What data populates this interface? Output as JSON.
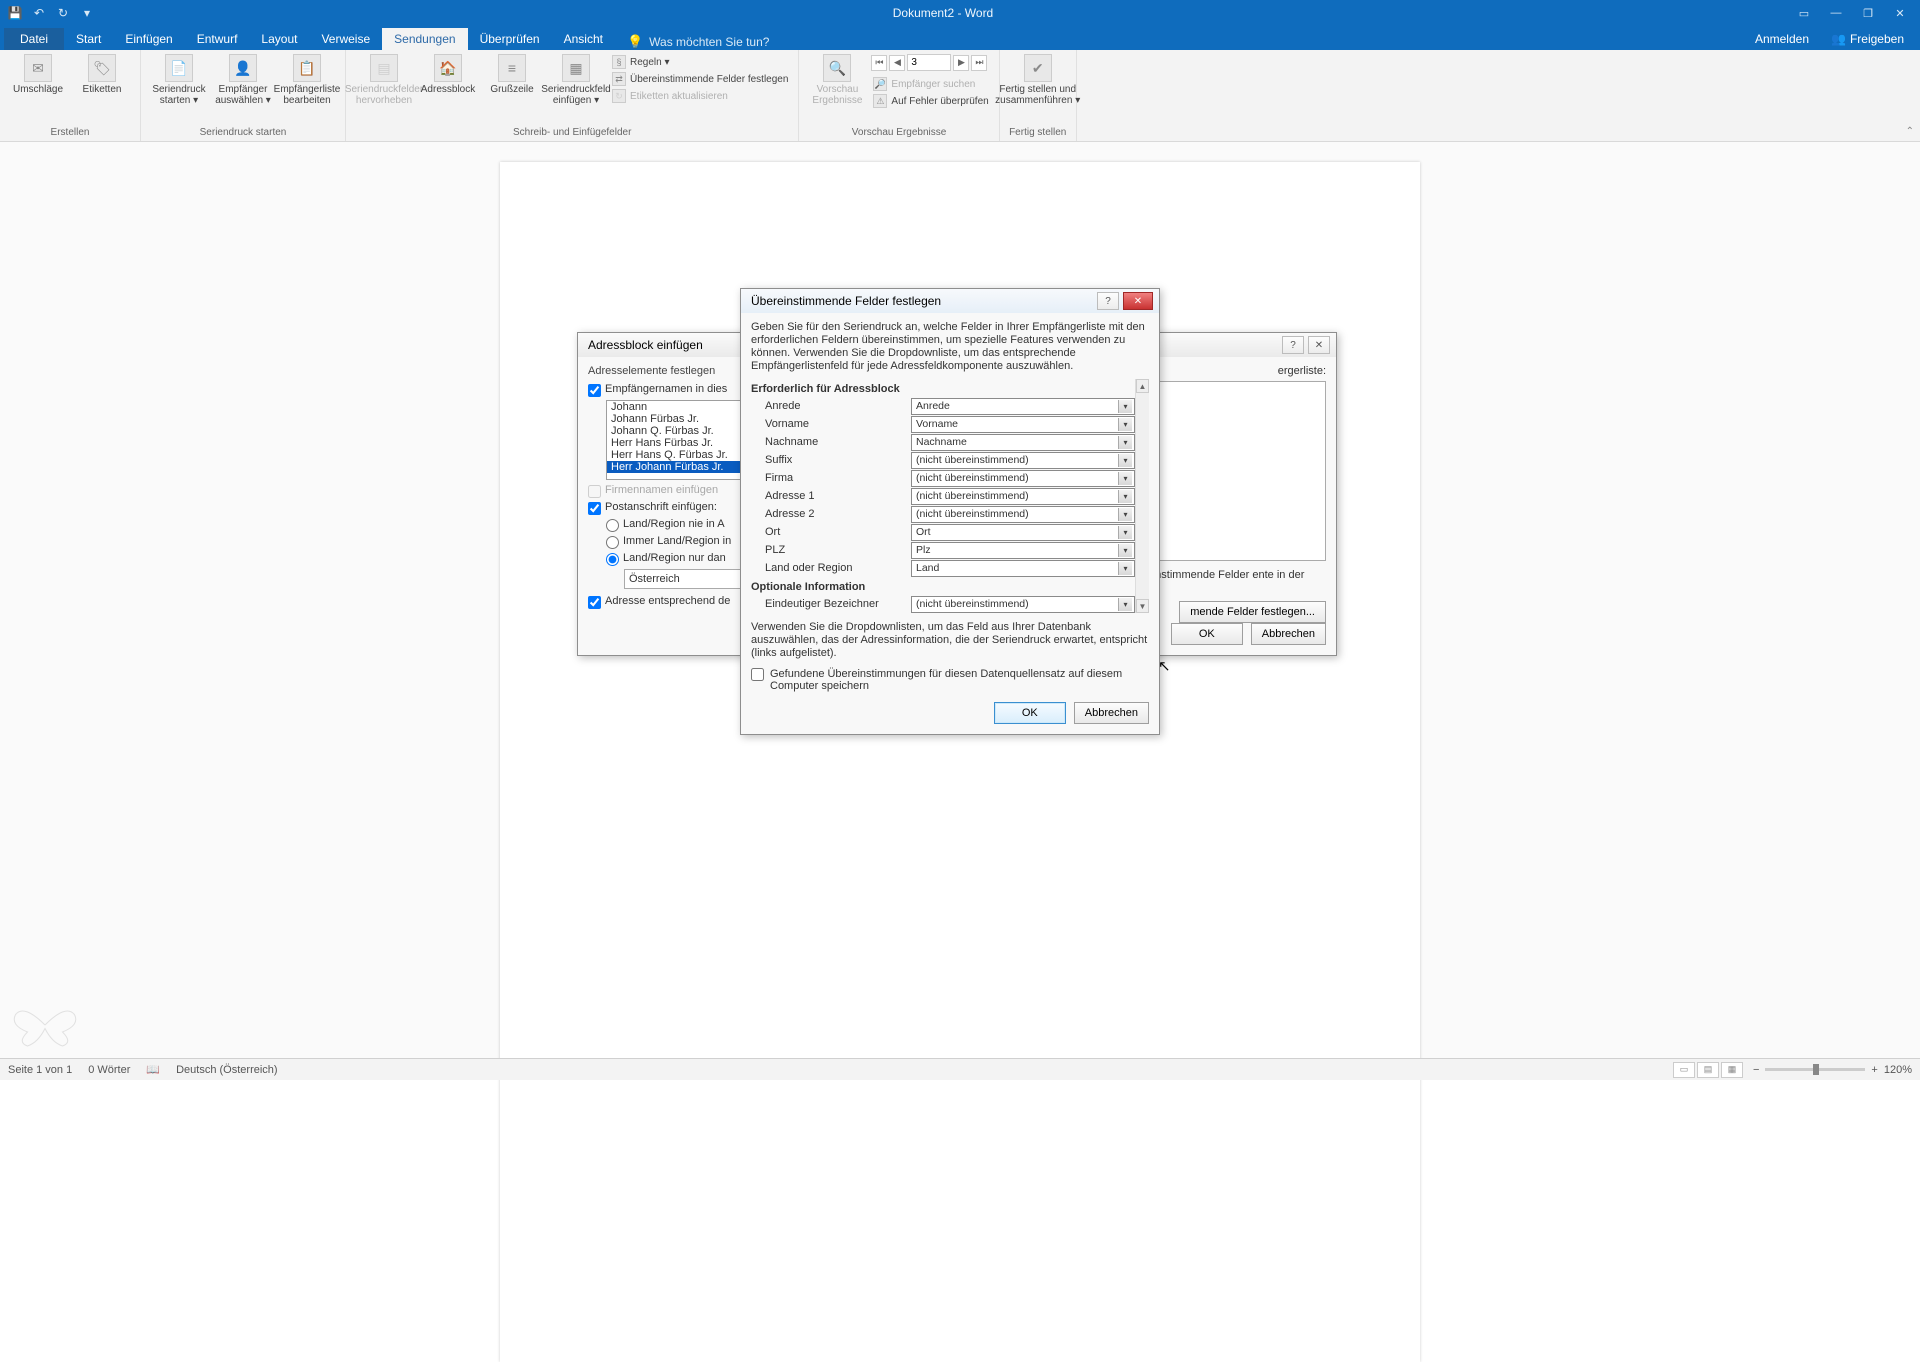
{
  "app": {
    "title": "Dokument2 - Word"
  },
  "qat": {
    "save": "💾",
    "undo": "↶",
    "redo": "↻",
    "more": "▾"
  },
  "win": {
    "ribbonopts": "▭",
    "min": "—",
    "restore": "❐",
    "close": "✕"
  },
  "tabs": {
    "file": "Datei",
    "home": "Start",
    "insert": "Einfügen",
    "design": "Entwurf",
    "layout": "Layout",
    "references": "Verweise",
    "mailings": "Sendungen",
    "review": "Überprüfen",
    "view": "Ansicht",
    "tellme": "Was möchten Sie tun?",
    "signin": "Anmelden",
    "share": "Freigeben"
  },
  "ribbon": {
    "create": {
      "envelopes": "Umschläge",
      "labels": "Etiketten",
      "group": "Erstellen"
    },
    "startmm": {
      "start": "Seriendruck\nstarten ▾",
      "select": "Empfänger\nauswählen ▾",
      "edit": "Empfängerliste\nbearbeiten",
      "group": "Seriendruck starten"
    },
    "write": {
      "highlight": "Seriendruckfelder\nhervorheben",
      "addr": "Adressblock",
      "greet": "Grußzeile",
      "insert": "Seriendruckfeld\neinfügen ▾",
      "rules": "Regeln ▾",
      "match": "Übereinstimmende Felder festlegen",
      "update": "Etiketten aktualisieren",
      "group": "Schreib- und Einfügefelder"
    },
    "preview": {
      "preview": "Vorschau\nErgebnisse",
      "num": "3",
      "find": "Empfänger suchen",
      "errors": "Auf Fehler überprüfen",
      "group": "Vorschau Ergebnisse"
    },
    "finish": {
      "finish": "Fertig stellen und\nzusammenführen ▾",
      "group": "Fertig stellen"
    }
  },
  "status": {
    "page": "Seite 1 von 1",
    "words": "0 Wörter",
    "lang": "Deutsch (Österreich)",
    "zoom": "120%"
  },
  "dlg1": {
    "title": "Adressblock einfügen",
    "section": "Adresselemente festlegen",
    "cb_names": "Empfängernamen in dies",
    "names": [
      "Johann",
      "Johann Fürbas Jr.",
      "Johann Q. Fürbas Jr.",
      "Herr Hans Fürbas Jr.",
      "Herr Hans Q. Fürbas Jr.",
      "Herr Johann Fürbas Jr."
    ],
    "cb_company": "Firmennamen einfügen",
    "cb_postal": "Postanschrift einfügen:",
    "r_never": "Land/Region nie in A",
    "r_always": "Immer Land/Region in",
    "r_only": "Land/Region nur dan",
    "r_country": "Österreich",
    "cb_format": "Adresse entsprechend de",
    "preview_h": "ergerliste:",
    "problem": "en oder falsch angeordnet \"Übereinstimmende Felder ente in der Adressenliste.",
    "match_btn": "mende Felder festlegen...",
    "ok": "OK",
    "cancel": "Abbrechen"
  },
  "dlg2": {
    "title": "Übereinstimmende Felder festlegen",
    "intro": "Geben Sie für den Seriendruck an, welche Felder in Ihrer Empfängerliste mit den erforderlichen Feldern übereinstimmen, um spezielle Features verwenden zu können. Verwenden Sie die Dropdownliste, um das entsprechende Empfängerlistenfeld für jede Adressfeldkomponente auszuwählen.",
    "req_h": "Erforderlich für Adressblock",
    "rows": [
      {
        "l": "Anrede",
        "v": "Anrede"
      },
      {
        "l": "Vorname",
        "v": "Vorname"
      },
      {
        "l": "Nachname",
        "v": "Nachname"
      },
      {
        "l": "Suffix",
        "v": "(nicht übereinstimmend)"
      },
      {
        "l": "Firma",
        "v": "(nicht übereinstimmend)"
      },
      {
        "l": "Adresse 1",
        "v": "(nicht übereinstimmend)"
      },
      {
        "l": "Adresse 2",
        "v": "(nicht übereinstimmend)"
      },
      {
        "l": "Ort",
        "v": "Ort"
      },
      {
        "l": "PLZ",
        "v": "Plz"
      },
      {
        "l": "Land oder Region",
        "v": "Land"
      }
    ],
    "opt_h": "Optionale Information",
    "opt_rows": [
      {
        "l": "Eindeutiger Bezeichner",
        "v": "(nicht übereinstimmend)"
      }
    ],
    "note": "Verwenden Sie die Dropdownlisten, um das Feld aus Ihrer Datenbank auszuwählen, das der Adressinformation, die der Seriendruck erwartet, entspricht (links aufgelistet).",
    "save": "Gefundene Übereinstimmungen für diesen Datenquellensatz auf diesem Computer speichern",
    "ok": "OK",
    "cancel": "Abbrechen"
  }
}
